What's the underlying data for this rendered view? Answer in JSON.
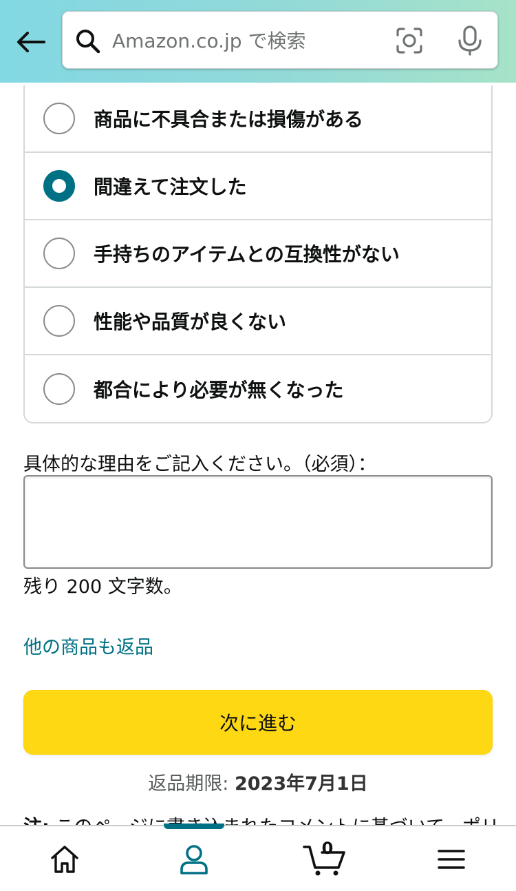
{
  "header": {
    "search_placeholder": "Amazon.co.jp で検索"
  },
  "reasons": [
    {
      "label": "商品に不具合または損傷がある",
      "selected": false
    },
    {
      "label": "間違えて注文した",
      "selected": true
    },
    {
      "label": "手持ちのアイテムとの互換性がない",
      "selected": false
    },
    {
      "label": "性能や品質が良くない",
      "selected": false
    },
    {
      "label": "都合により必要が無くなった",
      "selected": false
    }
  ],
  "details": {
    "label": "具体的な理由をご記入ください。（必須）：",
    "value": "",
    "char_count": "残り 200 文字数。"
  },
  "links": {
    "other_items": "他の商品も返品"
  },
  "actions": {
    "next_label": "次に進む"
  },
  "deadline": {
    "label": "返品期限: ",
    "date": "2023年7月1日"
  },
  "note": {
    "label": "注:",
    "text": " このページに書き込まれたコメントに基づいて、ポリ"
  },
  "bottom_nav": {
    "cart_count": "0",
    "active": "account"
  },
  "colors": {
    "accent": "#007185",
    "button": "#ffd814",
    "header_start": "#82d8e3",
    "header_end": "#a6e3c8"
  }
}
